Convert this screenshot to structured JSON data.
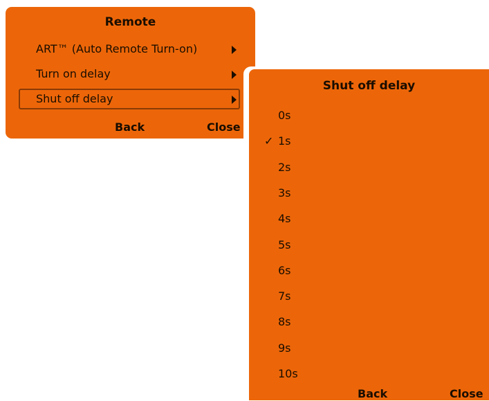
{
  "main_menu": {
    "title": "Remote",
    "items": [
      {
        "label": "ART™ (Auto Remote Turn-on)",
        "has_submenu": true
      },
      {
        "label": "Turn on delay",
        "has_submenu": true
      },
      {
        "label": "Shut off delay",
        "has_submenu": true,
        "selected": true
      }
    ],
    "back_label": "Back",
    "close_label": "Close"
  },
  "submenu": {
    "title": "Shut off delay",
    "check_mark": "✓",
    "selected_index": 1,
    "options": [
      "0s",
      "1s",
      "2s",
      "3s",
      "4s",
      "5s",
      "6s",
      "7s",
      "8s",
      "9s",
      "10s"
    ],
    "back_label": "Back",
    "close_label": "Close"
  },
  "colors": {
    "panel": "#ec6609",
    "text": "#1a0d00",
    "selection_border": "#8a3a05",
    "background": "#ffffff"
  },
  "icons": {
    "submenu_arrow": "chevron-right-icon",
    "check": "check-icon"
  }
}
